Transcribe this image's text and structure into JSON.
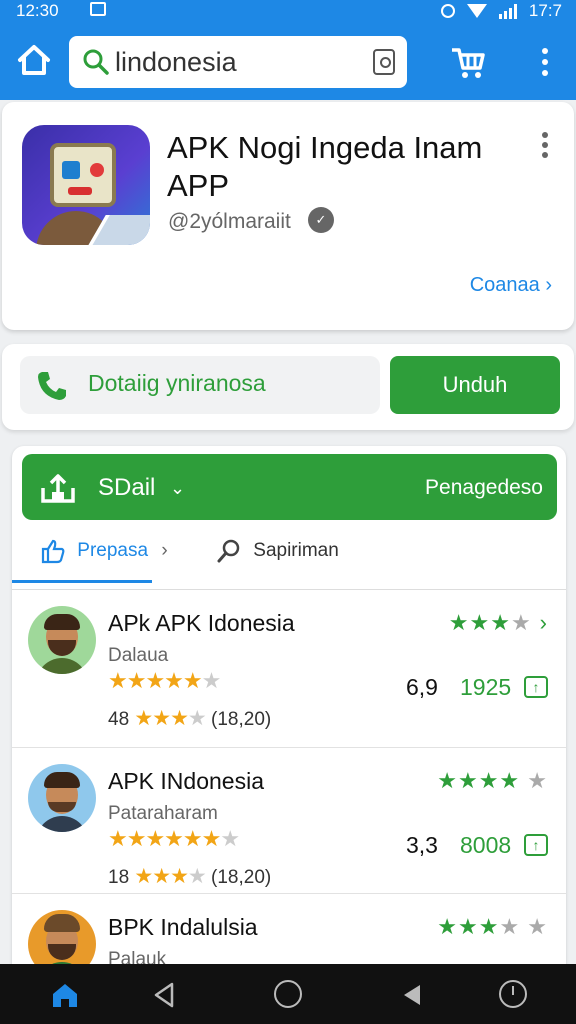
{
  "status_bar": {
    "time": "12:30",
    "battery": "17:7"
  },
  "app_bar": {
    "search_value": "lindonesia",
    "accent": "#1e88e5"
  },
  "app_card": {
    "title": "APK Nogi Ingeda Inam APP",
    "developer": "@2yólmaraiit",
    "link_label": "Coanaa"
  },
  "install_row": {
    "detail_label": "Dotaiig yniranosa",
    "install_button": "Unduh",
    "green": "#2e9e3a"
  },
  "list_header": {
    "selector_label": "SDail",
    "right_label": "Penagedeso",
    "tabs": [
      "Prepasa",
      "Sapiriman"
    ]
  },
  "apps": [
    {
      "title": "APk APK Idonesia",
      "subtitle": "Dalaua",
      "rating_stars_gold": 4.5,
      "rating_stars_green": 3.5,
      "small_count": "48",
      "reviews": "(18,20)",
      "score": "6,9",
      "installs": "1925",
      "avatar_bg": "#9fd89a",
      "avatar_shirt": "#4c6b2d"
    },
    {
      "title": "APK INdonesia",
      "subtitle": "Pataraharam",
      "rating_stars_gold": 5,
      "rating_stars_green": 4.5,
      "small_count": "18",
      "reviews": "(18,20)",
      "score": "3,3",
      "installs": "8008",
      "avatar_bg": "#8fc8ec",
      "avatar_shirt": "#2f3d4f"
    },
    {
      "title": "BPK Indalulsia",
      "subtitle": "Palauk",
      "rating_stars_green": 3.5,
      "avatar_bg": "#e89a2a",
      "avatar_shirt": "#2e7a34"
    }
  ],
  "icons": [
    "home-icon",
    "search-icon",
    "clipboard-icon",
    "cart-icon",
    "more-icon",
    "phone-icon",
    "download-icon",
    "like-icon",
    "search-icon",
    "back-icon",
    "circle-icon",
    "recent-icon"
  ]
}
